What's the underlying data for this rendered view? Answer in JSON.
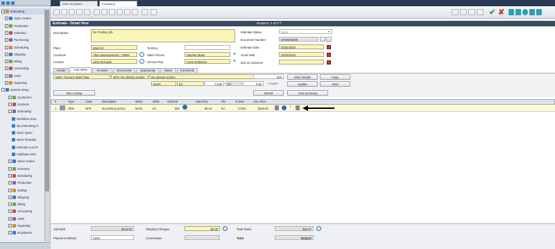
{
  "top_tabs": [
    "Work Templates",
    "Estimating"
  ],
  "sidebar": {
    "items": [
      {
        "label": "Estimating",
        "level": 0,
        "selected": true
      },
      {
        "label": "Sales Orders",
        "level": 1
      },
      {
        "label": "Production",
        "level": 1
      },
      {
        "label": "Inventory",
        "level": 1
      },
      {
        "label": "Purchasing",
        "level": 1
      },
      {
        "label": "Scheduling",
        "level": 1
      },
      {
        "label": "Shipping",
        "level": 1
      },
      {
        "label": "Billing",
        "level": 1
      },
      {
        "label": "Accounting",
        "level": 1
      },
      {
        "label": "CRM",
        "level": 1
      },
      {
        "label": "Reporting",
        "level": 1
      },
      {
        "label": "System Setup",
        "level": 0
      },
      {
        "label": "Customers",
        "level": 2
      },
      {
        "label": "Contacts",
        "level": 2
      },
      {
        "label": "Estimating",
        "level": 2
      },
      {
        "label": "Workflow Grou",
        "level": 3
      },
      {
        "label": "My Estimating S",
        "level": 3
      },
      {
        "label": "Work Types",
        "level": 3
      },
      {
        "label": "Work Template",
        "level": 3
      },
      {
        "label": "Estimate Lost R",
        "level": 3
      },
      {
        "label": "Validation Mes",
        "level": 3
      },
      {
        "label": "Sales Orders",
        "level": 2
      },
      {
        "label": "Inventory",
        "level": 2
      },
      {
        "label": "Scheduling",
        "level": 2
      },
      {
        "label": "Production",
        "level": 2
      },
      {
        "label": "Mailing",
        "level": 2
      },
      {
        "label": "Shipping",
        "level": 2
      },
      {
        "label": "Billing",
        "level": 2
      },
      {
        "label": "Accounting",
        "level": 2
      },
      {
        "label": "CRM",
        "level": 2
      },
      {
        "label": "Reporting",
        "level": 2
      },
      {
        "label": "Employees",
        "level": 2
      }
    ]
  },
  "header": {
    "title": "Estimate - Detail View",
    "revision": "Revision: 0 of 0"
  },
  "form": {
    "description_label": "Description",
    "description_value": "No Printing Job",
    "plant_label": "Plant",
    "plant_value": "Main D1",
    "territory_label": "Territory",
    "customer_label": "Customer",
    "customer_value": "Afton Manufacturing - 10000",
    "salesperson_label": "Sales Person",
    "salesperson_value": "Stephen Buss",
    "contact_label": "Contact",
    "contact_value": "John Richards",
    "servicerep_label": "Service Rep",
    "servicerep_value": "Arron Robinson",
    "status_label": "Estimate Status",
    "status_value": "Open",
    "docnum_label": "Document Number",
    "docnum_value": "ST00000299",
    "estdate_label": "Estimate Date",
    "estdate_value": "03/22/2016",
    "gooduntil_label": "Good Until",
    "gooduntil_value": "03/23/2016",
    "due_label": "Due at Customer"
  },
  "detail_tabs": [
    "Details",
    "Line Items",
    "Sections",
    "Documents",
    "Opportunity",
    "Notes",
    "Comments"
  ],
  "lines": {
    "worktype": "GEN: *Generic Work Type",
    "section": "NPS: No printing section",
    "section2": "No printing section",
    "qty": "500",
    "plant": "MAIN",
    "uom": "EA",
    "price": "0.230",
    "uom2": "EA",
    "amount": "0.00",
    "expire": "+ Expire",
    "enter_details": "Enter Details",
    "copy": "Copy",
    "update": "Update",
    "clear": "Clear",
    "item_lookup": "Item Lookup",
    "wizard": "Wizard",
    "cost_summary": "Cost Summary"
  },
  "grid": {
    "headers": [
      "#",
      "Type",
      "Code",
      "Description",
      "Whse",
      "UOM",
      "Ordered",
      "Unit Price",
      "Per",
      "% Disc.",
      "Ext. Price"
    ],
    "row": [
      "1",
      "GEN",
      "NPS",
      "No printing section",
      "MAIN",
      "EA",
      "500",
      "$0.24",
      "EA",
      "0.00%",
      "$115.00"
    ]
  },
  "footer": {
    "subtotal_label": "SubTotal",
    "subtotal_value": "$115.00",
    "shipping_label": "Shipping Charges",
    "shipping_value": "$0.00",
    "taxes_label": "Total Taxes",
    "taxes_value": "$15.47",
    "payment_label": "Payment Method",
    "payment_value": "Cash",
    "commission_label": "Commission",
    "total_label": "Total",
    "total_value": "$134.47"
  },
  "colors": {
    "accent": "#2a6bb5",
    "field": "#faf6b8",
    "titlebar": "#3b4a63"
  }
}
